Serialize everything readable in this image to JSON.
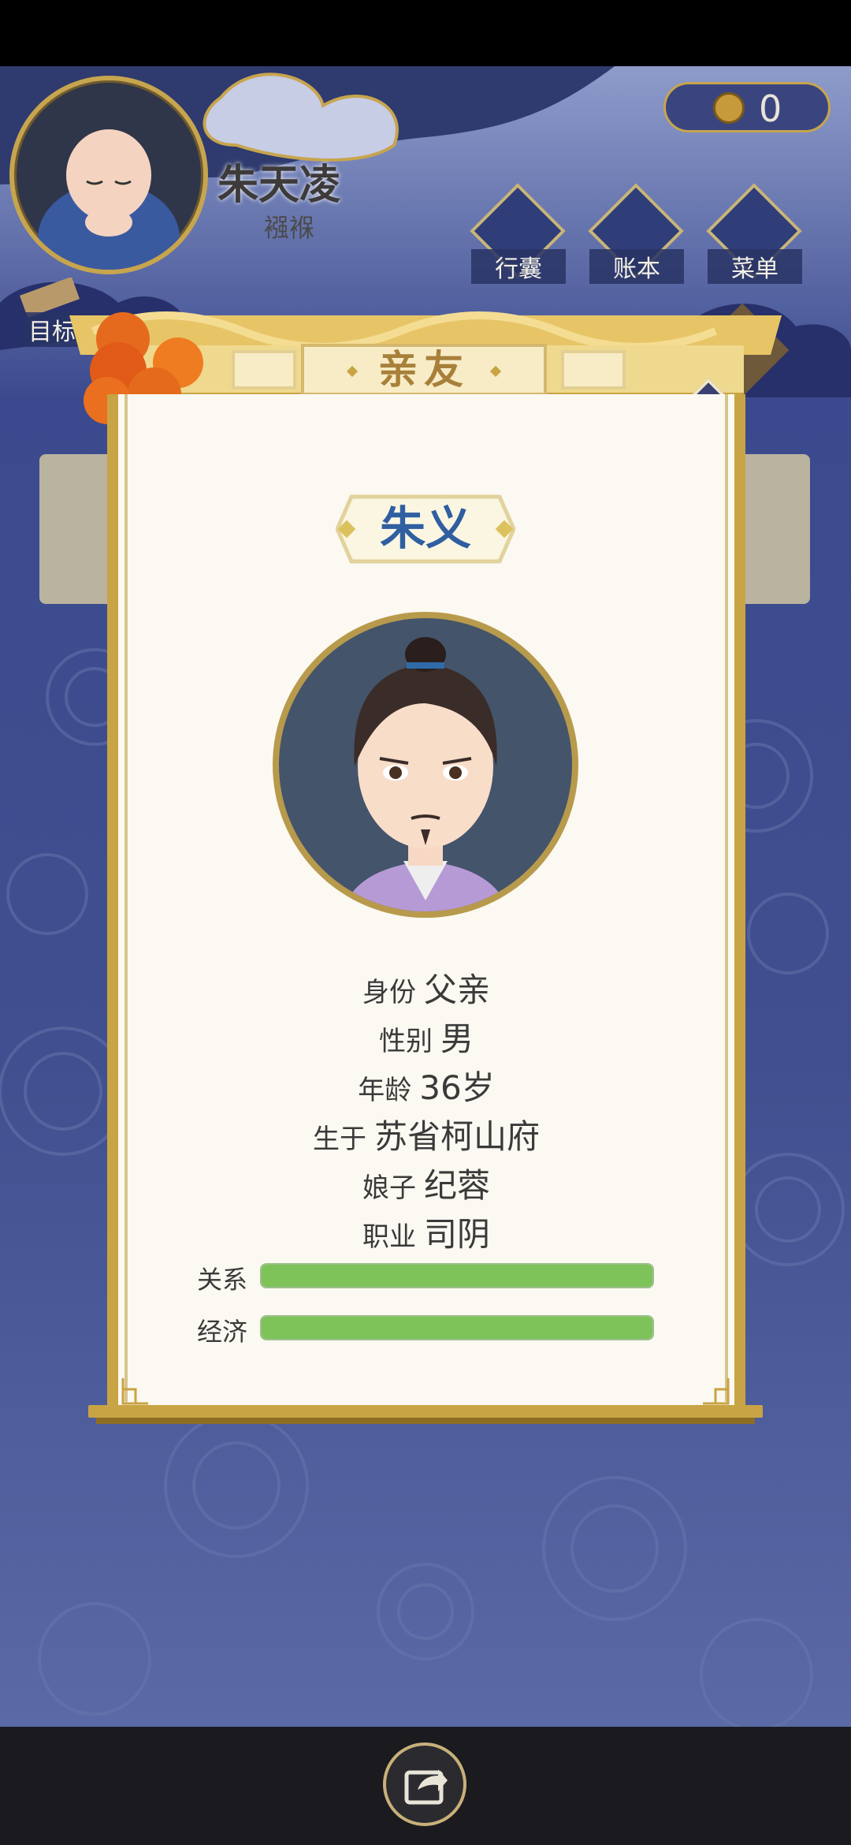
{
  "player": {
    "name": "朱天凌",
    "status": "襁褓"
  },
  "currency": {
    "icon": "copper-coin-icon",
    "count": "0"
  },
  "menu": {
    "bag": "行囊",
    "ledger": "账本",
    "menu": "菜单"
  },
  "goal": {
    "label": "目标"
  },
  "background_panel": {
    "title": "亲友"
  },
  "modal": {
    "header": "亲友",
    "name": "朱义",
    "info": [
      {
        "key": "身份",
        "value": "父亲"
      },
      {
        "key": "性别",
        "value": "男"
      },
      {
        "key": "年龄",
        "value": "36岁"
      },
      {
        "key": "生于",
        "value": "苏省柯山府"
      },
      {
        "key": "娘子",
        "value": "纪蓉"
      },
      {
        "key": "职业",
        "value": "司阴"
      }
    ],
    "bars": [
      {
        "label": "关系",
        "value": 1.0
      },
      {
        "label": "经济",
        "value": 1.0
      }
    ]
  },
  "colors": {
    "gold": "#c9a444",
    "bar_green": "#7dc35a",
    "name_blue": "#2f5fa0",
    "bg_blue": "#404f8f"
  }
}
